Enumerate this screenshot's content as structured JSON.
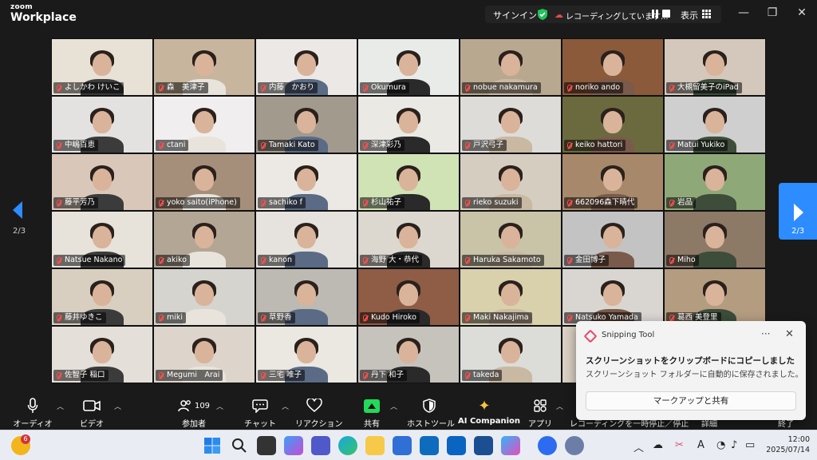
{
  "app": {
    "logo_line1": "zoom",
    "logo_line2": "Workplace"
  },
  "topbar": {
    "signin": "サインイン",
    "recording": "レコーディングしています...",
    "view": "表示"
  },
  "window_controls": {
    "minimize": "—",
    "restore": "❐",
    "close": "✕"
  },
  "pagination": {
    "left_page": "2/3",
    "right_page": "2/3"
  },
  "participants": [
    {
      "name": "よしかわ けいこ",
      "bg": "#e8e2d6"
    },
    {
      "name": "森　美津子",
      "bg": "#c7b59e"
    },
    {
      "name": "内藤　かおり",
      "bg": "#ece8e6"
    },
    {
      "name": "Okumura",
      "bg": "#e9ebe8"
    },
    {
      "name": "nobue nakamura",
      "bg": "#b8a890"
    },
    {
      "name": "noriko ando",
      "bg": "#8a5a3a"
    },
    {
      "name": "大槻留美子のiPad",
      "bg": "#d3c8bb"
    },
    {
      "name": "中嶋百恵",
      "bg": "#e4e2e0"
    },
    {
      "name": "ctani",
      "bg": "#f0eeee"
    },
    {
      "name": "Tamaki Kato",
      "bg": "#a39a8e"
    },
    {
      "name": "深津彩乃",
      "bg": "#ebe9e4"
    },
    {
      "name": "戸沢弓子",
      "bg": "#dedcd8"
    },
    {
      "name": "keiko hattori",
      "bg": "#6b6a3e"
    },
    {
      "name": "Matui Yukiko",
      "bg": "#cfcfcf"
    },
    {
      "name": "藤平芳乃",
      "bg": "#d9c8ba"
    },
    {
      "name": "yoko saito(iPhone)",
      "bg": "#a58f7a"
    },
    {
      "name": "sachiko f",
      "bg": "#ece9e4"
    },
    {
      "name": "杉山祐子",
      "bg": "#cfe3b5"
    },
    {
      "name": "rieko suzuki",
      "bg": "#d6cdc1"
    },
    {
      "name": "662096森下晴代",
      "bg": "#a8886a"
    },
    {
      "name": "岩品",
      "bg": "#8fa878"
    },
    {
      "name": "Natsue Nakano",
      "bg": "#e7e3db"
    },
    {
      "name": "akiko",
      "bg": "#b3a695"
    },
    {
      "name": "kanon",
      "bg": "#e6e3de"
    },
    {
      "name": "海野 大・恭代",
      "bg": "#ddd8cf"
    },
    {
      "name": "Haruka Sakamoto",
      "bg": "#c9c3a8"
    },
    {
      "name": "金田博子",
      "bg": "#c4c3c3"
    },
    {
      "name": "Miho",
      "bg": "#8c7966"
    },
    {
      "name": "藤井ゆきこ",
      "bg": "#d8cfc1"
    },
    {
      "name": "miki",
      "bg": "#d5d4cf"
    },
    {
      "name": "草野香",
      "bg": "#bdbab4"
    },
    {
      "name": "Kudo Hiroko",
      "bg": "#8f5c46"
    },
    {
      "name": "Maki Nakajima",
      "bg": "#d9d0ac"
    },
    {
      "name": "Natsuko Yamada",
      "bg": "#d9d6d2"
    },
    {
      "name": "葛西 美登里",
      "bg": "#b49c80"
    },
    {
      "name": "佐智子 稲口",
      "bg": "#e4dfd8"
    },
    {
      "name": "Megumi　Arai",
      "bg": "#ddd5cb"
    },
    {
      "name": "三宅 唯子",
      "bg": "#ebe8e2"
    },
    {
      "name": "丹下 和子",
      "bg": "#c6c2bc"
    },
    {
      "name": "takeda",
      "bg": "#dcdcd8"
    },
    {
      "name": "",
      "bg": "#d9cfc3"
    },
    {
      "name": "",
      "bg": "#cbc5bd"
    }
  ],
  "toolbar": {
    "audio": "オーディオ",
    "video": "ビデオ",
    "participants": "参加者",
    "participant_count": "109",
    "chat": "チャット",
    "reactions": "リアクション",
    "share": "共有",
    "host_tools": "ホストツール",
    "ai_companion": "AI Companion",
    "apps": "アプリ",
    "recording_status": "レコーディングを一時停止／停止",
    "details": "詳細",
    "end": "終了"
  },
  "toast": {
    "app": "Snipping Tool",
    "title": "スクリーンショットをクリップボードにコピーしました",
    "body": "スクリーンショット フォルダーに自動的に保存されました。",
    "button": "マークアップと共有"
  },
  "taskbar": {
    "weather_badge": "6",
    "time": "12:00",
    "date": "2025/07/14",
    "ime": "A"
  }
}
